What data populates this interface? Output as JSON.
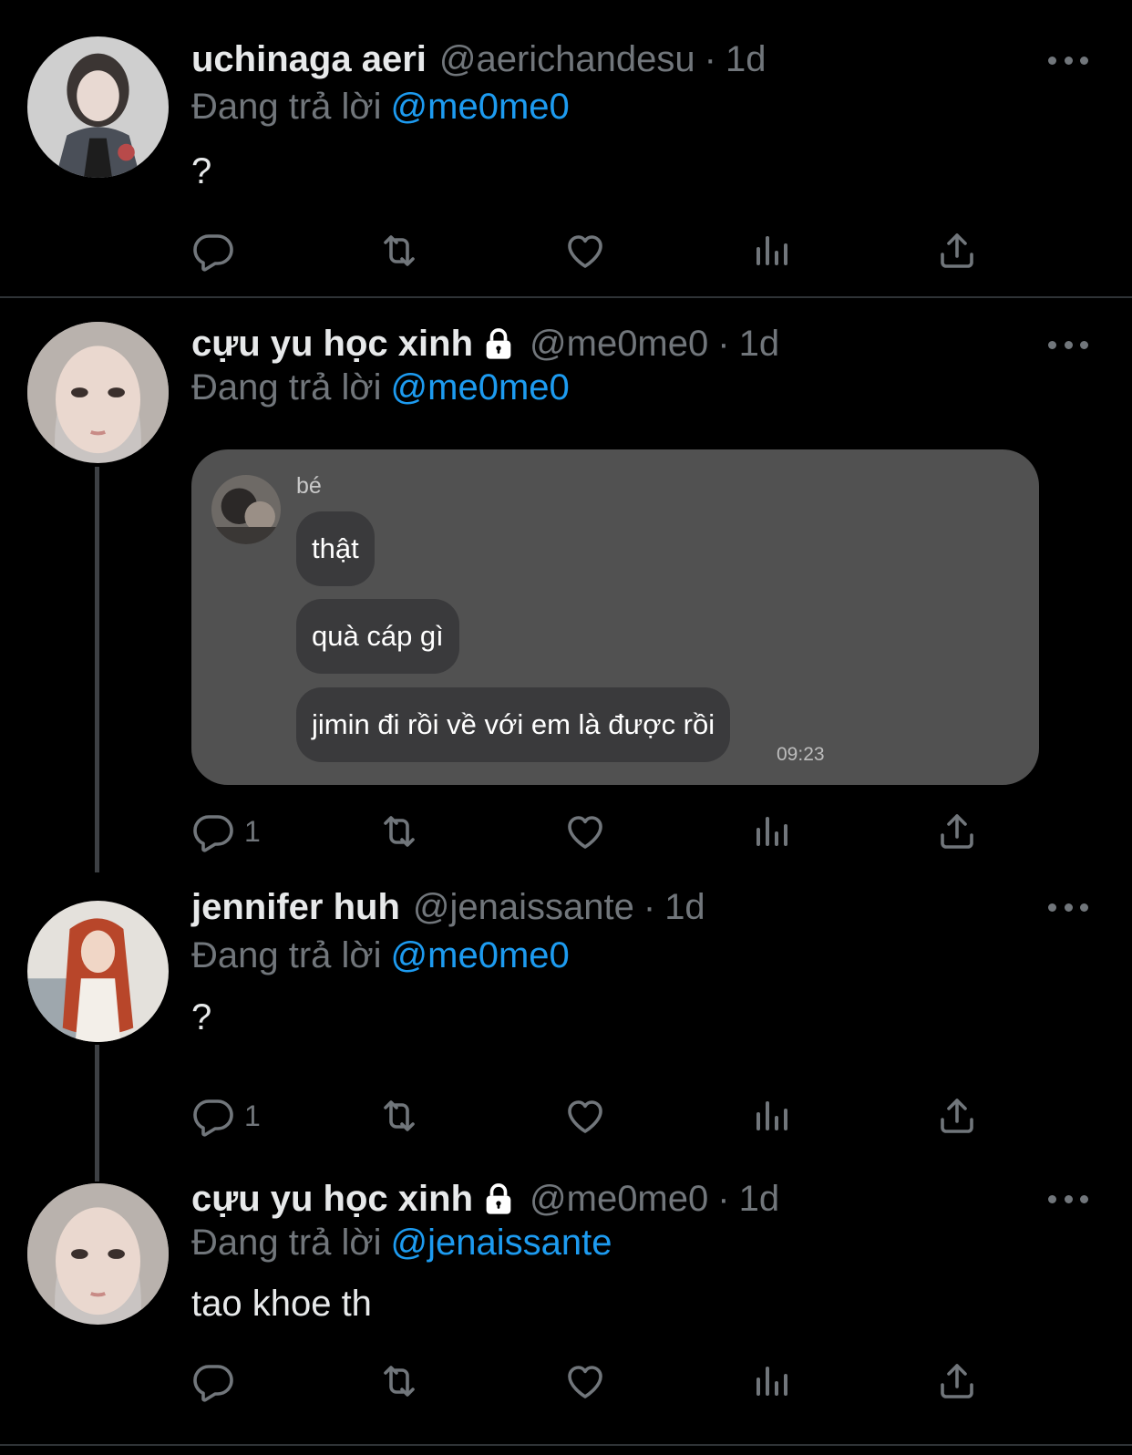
{
  "reply_prefix": "Đang trả lời",
  "tweets": [
    {
      "name": "uchinaga aeri",
      "handle": "@aerichandesu",
      "time": "1d",
      "reply_to": "@me0me0",
      "text": "?",
      "reply_count": ""
    },
    {
      "name": "cựu yu học xinh",
      "handle": "@me0me0",
      "time": "1d",
      "reply_to": "@me0me0",
      "reply_count": "1",
      "media": {
        "chat_name": "bé",
        "messages": [
          "thật",
          "quà cáp gì",
          "jimin đi rồi về với em là được rồi"
        ],
        "time": "09:23"
      }
    },
    {
      "name": "jennifer huh",
      "handle": "@jenaissante",
      "time": "1d",
      "reply_to": "@me0me0",
      "text": "?",
      "reply_count": "1"
    },
    {
      "name": "cựu yu học xinh",
      "handle": "@me0me0",
      "time": "1d",
      "reply_to": "@jenaissante",
      "text": "tao khoe th",
      "reply_count": ""
    }
  ],
  "icons": {
    "reply": "reply-icon",
    "retweet": "retweet-icon",
    "like": "heart-icon",
    "views": "analytics-icon",
    "share": "share-icon",
    "more": "more-icon",
    "lock": "lock-icon"
  },
  "colors": {
    "background": "#000000",
    "mention": "#1d9bf0",
    "secondary": "#71767b",
    "media_bg": "#515151",
    "bubble": "#3a3a3c"
  }
}
